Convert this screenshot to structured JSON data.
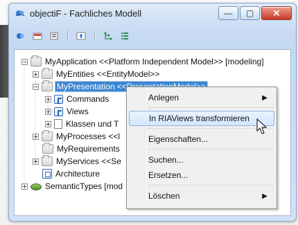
{
  "window": {
    "title": "objectiF - Fachliches Modell",
    "controls": {
      "minimize": "—",
      "maximize": "▢",
      "close": "✕"
    }
  },
  "toolbar": {
    "icons": [
      "refresh-icon",
      "card-icon",
      "properties-icon",
      "up-icon",
      "tree-view-icon",
      "list-view-icon"
    ]
  },
  "tree": {
    "items": [
      {
        "label": "MyApplication <<Platform Independent Model>> [modeling]"
      },
      {
        "label": "MyEntities <<EntityModel>>"
      },
      {
        "label": "MyPresentation <<PresentationModel>>"
      },
      {
        "label": "Commands"
      },
      {
        "label": "Views"
      },
      {
        "label": "Klassen und T"
      },
      {
        "label": "MyProcesses <<l"
      },
      {
        "label": "MyRequirements"
      },
      {
        "label": "MyServices <<Se"
      },
      {
        "label": "Architecture"
      },
      {
        "label": "SemanticTypes [mod"
      }
    ]
  },
  "context_menu": {
    "items": [
      {
        "label": "Anlegen",
        "submenu_arrow": "▶"
      },
      {
        "label": "In RIAViews transformieren"
      },
      {
        "label": "Eigenschaften..."
      },
      {
        "label": "Suchen..."
      },
      {
        "label": "Ersetzen..."
      },
      {
        "label": "Löschen",
        "submenu_arrow": "▶"
      }
    ]
  }
}
